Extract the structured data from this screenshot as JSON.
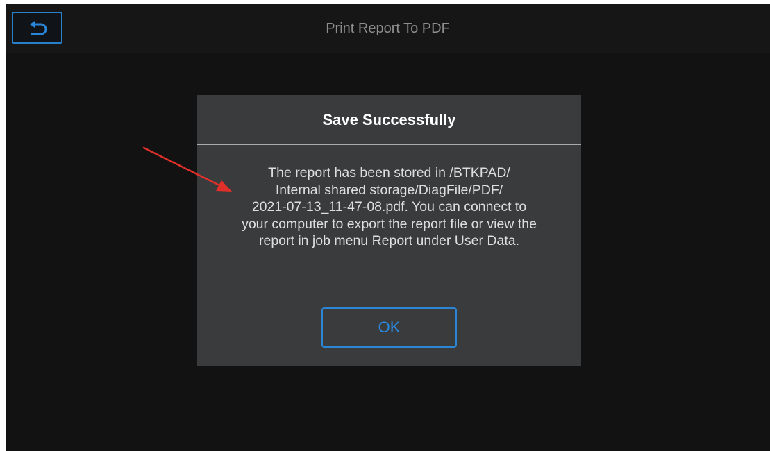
{
  "header": {
    "title": "Print Report To PDF",
    "back_icon": "back-return-icon"
  },
  "dialog": {
    "title": "Save Successfully",
    "message_lines": [
      "The report has been stored in /BTKPAD/",
      "Internal shared storage/DiagFile/PDF/",
      "2021-07-13_11-47-08.pdf. You can connect to",
      "your computer to export the report file or view the",
      "report in job menu Report under User Data."
    ],
    "ok_label": "OK"
  },
  "annotation": {
    "type": "arrow",
    "color": "#e0302a"
  },
  "colors": {
    "accent": "#2b86d6",
    "dialog_background": "#3a3b3d",
    "screen_background": "#121212"
  }
}
